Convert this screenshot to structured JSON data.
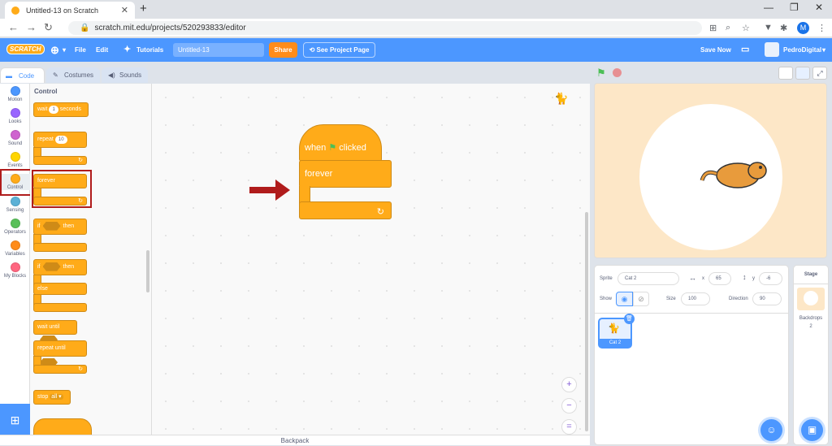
{
  "browser": {
    "tab_title": "Untitled-13 on Scratch",
    "url": "scratch.mit.edu/projects/520293833/editor",
    "profile_initial": "M"
  },
  "menubar": {
    "logo": "SCRATCH",
    "file": "File",
    "edit": "Edit",
    "tutorials": "Tutorials",
    "project_title": "Untitled-13",
    "share": "Share",
    "see_project_page": "See Project Page",
    "save_now": "Save Now",
    "username": "PedroDigital"
  },
  "editor_tabs": {
    "code": "Code",
    "costumes": "Costumes",
    "sounds": "Sounds"
  },
  "categories": [
    {
      "label": "Motion",
      "color": "#4c97ff"
    },
    {
      "label": "Looks",
      "color": "#9966ff"
    },
    {
      "label": "Sound",
      "color": "#cf63cf"
    },
    {
      "label": "Events",
      "color": "#ffd500"
    },
    {
      "label": "Control",
      "color": "#ffab19"
    },
    {
      "label": "Sensing",
      "color": "#5cb1d6"
    },
    {
      "label": "Operators",
      "color": "#59c059"
    },
    {
      "label": "Variables",
      "color": "#ff8c1a"
    },
    {
      "label": "My Blocks",
      "color": "#ff6680"
    }
  ],
  "palette": {
    "heading": "Control",
    "wait": "wait",
    "wait_value": "1",
    "seconds": "seconds",
    "repeat": "repeat",
    "repeat_value": "10",
    "forever": "forever",
    "if": "if",
    "then": "then",
    "else": "else",
    "wait_until": "wait until",
    "repeat_until": "repeat until",
    "stop": "stop",
    "stop_value": "all"
  },
  "script": {
    "when": "when",
    "clicked": "clicked",
    "forever": "forever"
  },
  "backpack": "Backpack",
  "sprite_info": {
    "sprite_label": "Sprite",
    "sprite_name": "Cat 2",
    "x_label": "x",
    "x": "65",
    "y_label": "y",
    "y": "-6",
    "show_label": "Show",
    "size_label": "Size",
    "size": "100",
    "direction_label": "Direction",
    "direction": "90"
  },
  "sprite_thumb": "Cat 2",
  "stage_panel": {
    "title": "Stage",
    "backdrops_label": "Backdrops",
    "backdrops_count": "2"
  },
  "colors": {
    "scratch_blue": "#4c97ff",
    "control": "#ffab19",
    "highlight": "#b01c1c"
  }
}
